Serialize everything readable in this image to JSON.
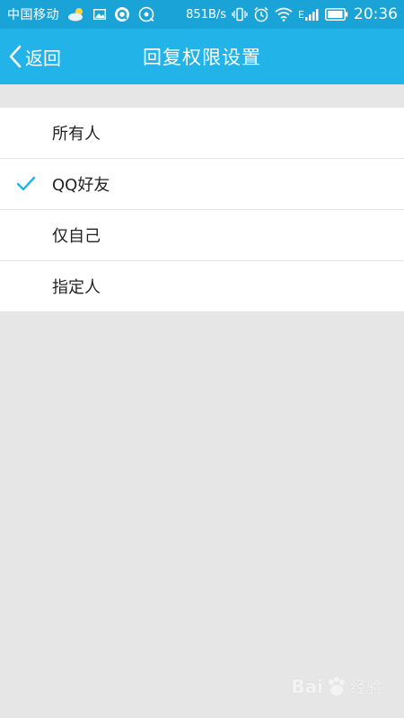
{
  "status_bar": {
    "carrier": "中国移动",
    "net_speed": "851B/s",
    "time": "20:36",
    "signal_label": "E",
    "icons": [
      "weather-icon",
      "image-icon",
      "q-app-icon",
      "media-icon",
      "vibrate-icon",
      "alarm-icon",
      "wifi-icon",
      "signal-icon",
      "battery-icon"
    ]
  },
  "header": {
    "back_label": "返回",
    "title": "回复权限设置",
    "icon": "chevron-left-icon"
  },
  "options": [
    {
      "label": "所有人",
      "selected": false
    },
    {
      "label": "QQ好友",
      "selected": true
    },
    {
      "label": "仅自己",
      "selected": false
    },
    {
      "label": "指定人",
      "selected": false
    }
  ],
  "watermark": {
    "brand": "Bai",
    "suffix": "经验"
  },
  "colors": {
    "status_bar": "#1aa3d7",
    "header": "#22b4e8",
    "check": "#22b4e8",
    "background": "#e6e6e6"
  }
}
